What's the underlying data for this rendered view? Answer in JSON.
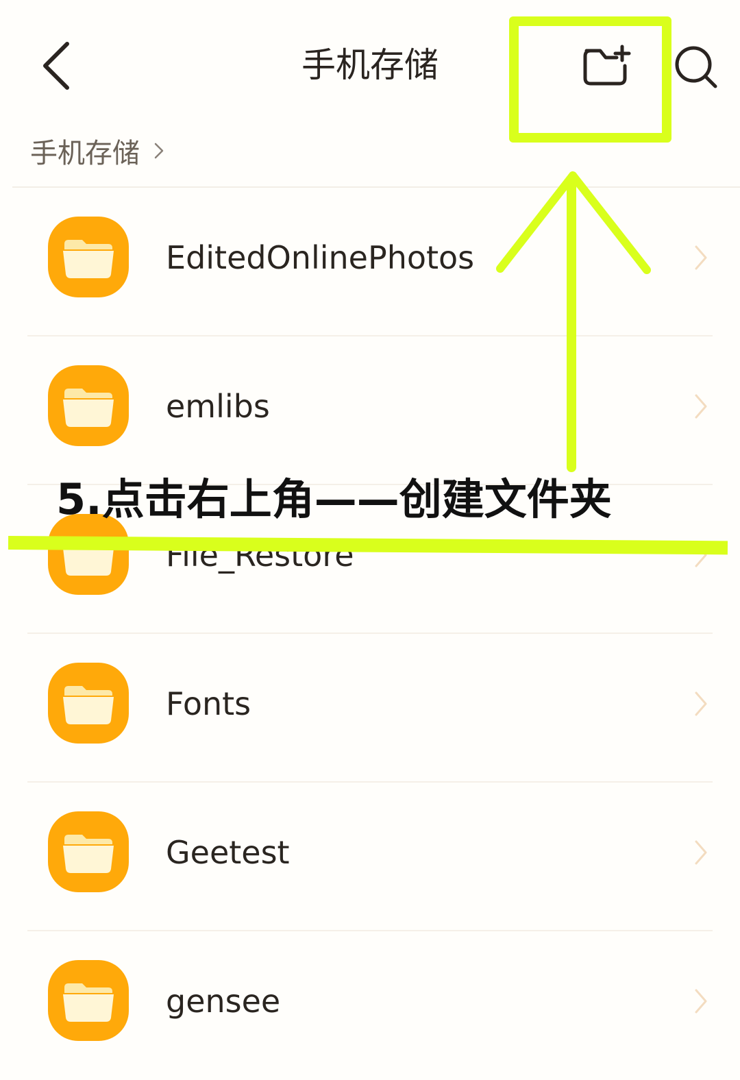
{
  "header": {
    "title": "手机存储",
    "back_icon": "chevron-left-icon",
    "new_folder_icon": "new-folder-icon",
    "search_icon": "search-icon"
  },
  "breadcrumb": {
    "items": [
      {
        "label": "手机存储"
      }
    ]
  },
  "folders": [
    {
      "name": "EditedOnlinePhotos"
    },
    {
      "name": "emlibs"
    },
    {
      "name": "File_Restore"
    },
    {
      "name": "Fonts"
    },
    {
      "name": "Geetest"
    },
    {
      "name": "gensee"
    }
  ],
  "annotation": {
    "caption": "5.点击右上角——创建文件夹",
    "highlight_color": "#d9ff1c"
  },
  "colors": {
    "folder": "#ffa90a",
    "folder_inner": "#fff6d6",
    "chevron": "#f3dcc0",
    "background": "#fffefb"
  }
}
